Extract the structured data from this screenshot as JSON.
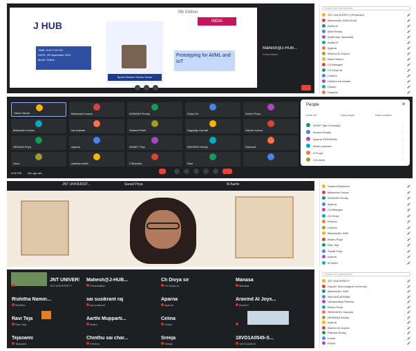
{
  "meeting_top": {
    "slide": {
      "brand": "J HUB",
      "badge": "5th Edition",
      "speaker_badge": "INDIA",
      "time_line": "TIME: 5:30-7:00 PM",
      "date_line": "DATE: 25 September 2021",
      "mode_line": "Mode: Online",
      "title_line": "Prototyping for AI/ML and IoT",
      "host_line": "Sprint Session Series Venue"
    },
    "presenter_label": "Mahesh@J-HUB...",
    "presenter_sub": "Presentation",
    "participants_search": "Search for participants",
    "participants": [
      "JNT UNIVERSITY (Presenter)",
      "Mahesh@J-HUB (Host)",
      "Aarthi M",
      "Akhil Reddy",
      "AnilKumar Vanamala",
      "Anitha B",
      "Aparna",
      "Aravind Al Joyson",
      "Bala Krishna",
      "Ch Bhargavi",
      "Ch Divya sir",
      "Chinthu",
      "Chinthu sai charan",
      "Dinesh",
      "Gayathri"
    ]
  },
  "meeting_mid": {
    "tiles": [
      "Harsh Varma",
      "Mahender Kumar",
      "AVINASH Reddy",
      "Divya Sri",
      "Surbhi Priya",
      "Mahender Kumar",
      "sai sushant",
      "Student Parth",
      "Nagaraju Karnati",
      "Vishnu Kumar",
      "SRIVANI Priya",
      "Aparna",
      "AVINEY Teja",
      "MAHEEN Reddy",
      "Hameed",
      "Venu",
      "Aathika Arathi",
      "S Bhavani",
      "Ravi",
      ""
    ],
    "time": "5:35 PM",
    "meeting_code": "abc-qjrt-abc",
    "people_panel": {
      "title": "People",
      "tabs": [
        "Invite all",
        "Add people",
        "Host controls"
      ],
      "rows": [
        "AGNIT Teja Chowdary",
        "Anusha Reddy",
        "Aparna SRINIVASU",
        "Bhanu prakash",
        "A Pooja",
        "Chi mehk"
      ]
    }
  },
  "meeting_bottom": {
    "top_labels": [
      "JNT UNIVERSIT...",
      "Sanali Priya",
      "M Aarthi"
    ],
    "participants": [
      "Student Research",
      "Mahender Kumar",
      "AVINASH Reddy",
      "Aparna",
      "Ch Bhargavi",
      "Ch Divya",
      "Krishna",
      "Chinthu",
      "Mahesh@J-HUB",
      "Bhanu Priya",
      "Ravi Teja",
      "Sanali Priya",
      "Aparna",
      "M Aarthi"
    ]
  },
  "meeting_grid": {
    "tiles": [
      {
        "name": "JNT UNIVERSIT...",
        "sub": "JNT UNIVERSITY"
      },
      {
        "name": "Mahesh@J-HUB...",
        "sub": "Presentation"
      },
      {
        "name": "Ch Divya sir",
        "sub": "Ch Divya sir"
      },
      {
        "name": "Manasa",
        "sub": "Manasa"
      },
      {
        "name": "Rishitha Namin...",
        "sub": "Rishitha"
      },
      {
        "name": "sai susikrant raj",
        "sub": "sai susikrant"
      },
      {
        "name": "Aparna",
        "sub": "Aparna"
      },
      {
        "name": "Aravind Al Joys...",
        "sub": "Aravind"
      },
      {
        "name": "Ravi Teja",
        "sub": "Ravi Teja"
      },
      {
        "name": "Aarthi Mupparti...",
        "sub": "Aarthi"
      },
      {
        "name": "Celina",
        "sub": "Celina"
      },
      {
        "name": "",
        "sub": ""
      },
      {
        "name": "Tejaswini",
        "sub": "Tejaswini"
      },
      {
        "name": "Chinthu sai char...",
        "sub": "Chinthu"
      },
      {
        "name": "Sreeja",
        "sub": "Sreeja"
      },
      {
        "name": "18VD1A0545-S...",
        "sub": "18VD1A0545"
      }
    ],
    "search": "Search for participants",
    "participants": [
      "JNT UNIVERSITY",
      "Gayatri Technological University",
      "Mahesh@J-HUB",
      "ANUSHA ARISMA",
      "Vikramaditya Sharma",
      "Bhanu Priya",
      "SRINIVASU Vennela",
      "NIHARIKA Reddy",
      "Aparna",
      "Aravind Al Joyson",
      "Rithvika Reddy",
      "Koneti",
      "Kavya"
    ]
  },
  "colors": {
    "dark_bg": "#1d1f22",
    "tile_bg": "#2b2d31",
    "accent_blue": "#1a73e8",
    "end_call_red": "#ea4335"
  }
}
